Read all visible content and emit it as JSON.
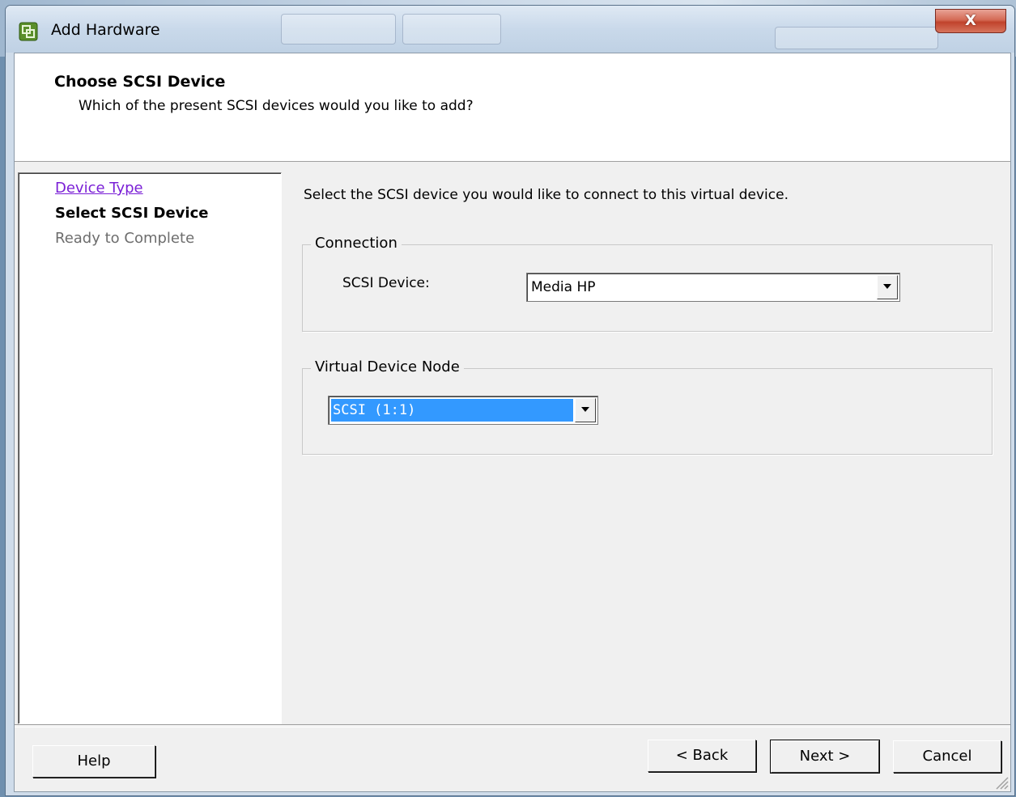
{
  "window": {
    "title": "Add Hardware",
    "close_label": "X"
  },
  "header": {
    "title": "Choose SCSI Device",
    "subtitle": "Which of the present SCSI devices would you like to add?"
  },
  "steps": [
    {
      "label": "Device Type",
      "state": "visited"
    },
    {
      "label": "Select SCSI Device",
      "state": "current"
    },
    {
      "label": "Ready to Complete",
      "state": "pending"
    }
  ],
  "main": {
    "instruction": "Select the SCSI device you would like to connect to this virtual device.",
    "connection": {
      "legend": "Connection",
      "scsi_device_label": "SCSI Device:",
      "scsi_device_value": "Media HP"
    },
    "virtual_node": {
      "legend": "Virtual Device Node",
      "value": "SCSI (1:1)"
    }
  },
  "buttons": {
    "help": "Help",
    "back": "< Back",
    "next": "Next >",
    "cancel": "Cancel"
  },
  "colors": {
    "visited_link": "#7a1fd6",
    "selection": "#3399ff",
    "dialog_bg": "#f0f0f0"
  }
}
